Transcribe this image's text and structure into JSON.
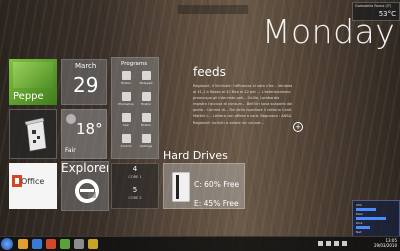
{
  "day": "Monday",
  "weather_mini": {
    "location": "Garbatella Roma (IT)",
    "temp": "53°C"
  },
  "calendar": {
    "month": "March",
    "date": "29"
  },
  "user": {
    "name": "Peppe"
  },
  "programs": {
    "title": "Programs",
    "items": [
      {
        "label": "Firefox"
      },
      {
        "label": "Notepad"
      },
      {
        "label": "Photoshop"
      },
      {
        "label": "Firefox"
      },
      {
        "label": "Calc"
      },
      {
        "label": "Firefox"
      },
      {
        "label": "Control"
      },
      {
        "label": "Settings"
      }
    ]
  },
  "weather": {
    "temp": "18°",
    "condition": "Fair"
  },
  "office": {
    "label": "Office"
  },
  "explorer": {
    "label": "Explorer"
  },
  "cpu": {
    "cores": [
      {
        "value": "4",
        "label": "CORE 1"
      },
      {
        "value": "5",
        "label": "CORE 2"
      }
    ]
  },
  "drives": {
    "title": "Hard Drives",
    "c": "C: 60% Free",
    "e": "E: 45% Free"
  },
  "feeds": {
    "title": "feeds",
    "body": "Regionali, il Viminale: l'affluenza al voto s'ite... Vendola al 41,1 a Raseo al 42 Bea al 42 per ... L'astensionismo preoccupa gli interviste poli... Sicilia, Lombardia registra l'accusa di consum... Bell'lilri sava scaparlo dai gioito : Comme di... Rui della riporitare il calliano Cardi. Mattini L... Lettera con offese a card. Bagnasco : ANSA Regionali: iscriviti a votare inc cannat..."
  },
  "sysmon": {
    "line1": "CPU",
    "line2": "Mem",
    "line3": "Disk",
    "line4": "Net"
  },
  "clock": {
    "time": "13:05",
    "date": "29/03/2010"
  },
  "colors": {
    "accent": "#7fc241",
    "start": "#1c4fa8"
  }
}
